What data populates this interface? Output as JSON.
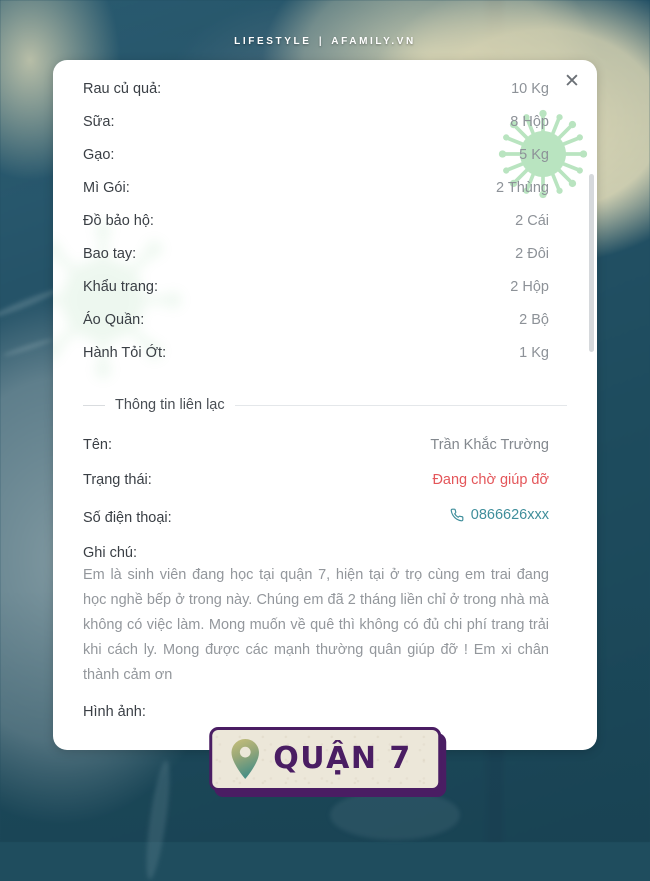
{
  "masthead": {
    "category": "LIFESTYLE",
    "separator": "|",
    "site": "AFAMILY.VN"
  },
  "card": {
    "close_label": "✕",
    "close_icon": "close-icon",
    "supplies": [
      {
        "label": "Rau củ quả:",
        "value": "10 Kg"
      },
      {
        "label": "Sữa:",
        "value": "8 Hộp"
      },
      {
        "label": "Gạo:",
        "value": "5 Kg"
      },
      {
        "label": "Mì Gói:",
        "value": "2 Thùng"
      },
      {
        "label": "Đồ bảo hộ:",
        "value": "2 Cái"
      },
      {
        "label": "Bao tay:",
        "value": "2 Đôi"
      },
      {
        "label": "Khẩu trang:",
        "value": "2 Hộp"
      },
      {
        "label": "Áo Quần:",
        "value": "2 Bộ"
      },
      {
        "label": "Hành Tỏi Ớt:",
        "value": "1 Kg"
      }
    ],
    "contact_section_title": "Thông tin liên lạc",
    "contact": {
      "name_label": "Tên:",
      "name_value": "Trần Khắc Trường",
      "status_label": "Trạng thái:",
      "status_value": "Đang chờ giúp đỡ",
      "phone_label": "Số điện thoại:",
      "phone_value": "0866626xxx",
      "phone_icon": "phone-icon"
    },
    "note_label": "Ghi chú:",
    "note_text": "Em là sinh viên đang học tại quận 7, hiện tại ở trọ cùng em trai đang học nghề bếp ở trong này. Chúng em đã 2 tháng liền chỉ ở trong nhà mà không có việc làm. Mong muốn về quê thì không có đủ chi phí trang trải khi cách ly. Mong được các mạnh thường quân giúp đỡ ! Em xi chân thành cảm ơn",
    "image_label": "Hình ảnh:"
  },
  "badge": {
    "text": "QUẬN 7",
    "icon": "location-pin-icon"
  },
  "colors": {
    "background_teal": "#1f4d5e",
    "card_white": "#ffffff",
    "label_text": "#3a3f45",
    "value_text": "#8d9298",
    "status_red": "#e4565a",
    "phone_teal": "#3f8e9b",
    "badge_purple": "#4a1d63",
    "badge_cream": "#ece7d9",
    "virus_green": "#8fd49a"
  }
}
